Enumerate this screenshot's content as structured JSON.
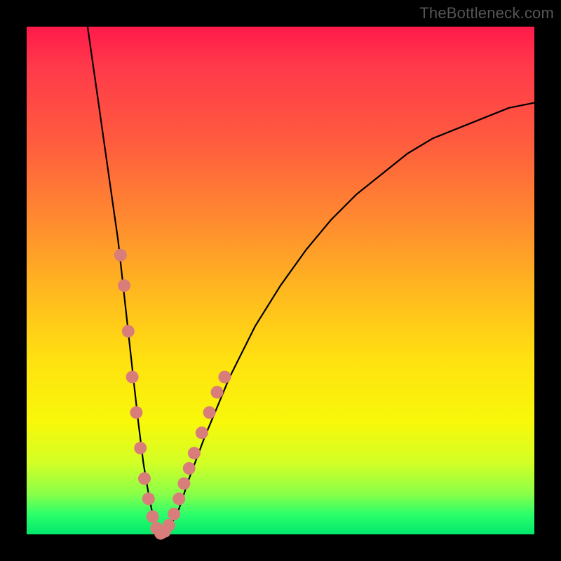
{
  "watermark": "TheBottleneck.com",
  "chart_data": {
    "type": "line",
    "title": "",
    "xlabel": "",
    "ylabel": "",
    "xlim": [
      0,
      100
    ],
    "ylim": [
      0,
      100
    ],
    "series": [
      {
        "name": "bottleneck-curve",
        "x": [
          12,
          14,
          16,
          18,
          19,
          20,
          21,
          22,
          23,
          24,
          25,
          26.5,
          28,
          30,
          32,
          35,
          40,
          45,
          50,
          55,
          60,
          65,
          70,
          75,
          80,
          85,
          90,
          95,
          100
        ],
        "y": [
          100,
          86,
          72,
          58,
          49,
          40,
          31,
          22,
          14,
          8,
          3,
          0,
          1,
          5,
          11,
          19,
          31,
          41,
          49,
          56,
          62,
          67,
          71,
          75,
          78,
          80,
          82,
          84,
          85
        ]
      }
    ],
    "markers": [
      {
        "name": "left-branch-dots",
        "color": "#d97d7a",
        "radius_px": 9,
        "points_xy": [
          [
            18.5,
            55
          ],
          [
            19.2,
            49
          ],
          [
            20.0,
            40
          ],
          [
            20.8,
            31
          ],
          [
            21.6,
            24
          ],
          [
            22.4,
            17
          ],
          [
            23.2,
            11
          ],
          [
            24.0,
            7
          ],
          [
            24.8,
            3.5
          ],
          [
            25.6,
            1.2
          ],
          [
            26.4,
            0.2
          ],
          [
            27.2,
            0.6
          ]
        ]
      },
      {
        "name": "right-branch-dots",
        "color": "#d97d7a",
        "radius_px": 9,
        "points_xy": [
          [
            28.0,
            1.8
          ],
          [
            29.0,
            4
          ],
          [
            30.0,
            7
          ],
          [
            31.0,
            10
          ],
          [
            32.0,
            13
          ],
          [
            33.0,
            16
          ],
          [
            34.5,
            20
          ],
          [
            36.0,
            24
          ],
          [
            37.5,
            28
          ],
          [
            39.0,
            31
          ]
        ]
      }
    ],
    "background_gradient": {
      "stops": [
        {
          "pos": 0.0,
          "color": "#ff1a4a"
        },
        {
          "pos": 0.22,
          "color": "#ff5a3f"
        },
        {
          "pos": 0.52,
          "color": "#ffb81f"
        },
        {
          "pos": 0.78,
          "color": "#f8f80a"
        },
        {
          "pos": 0.92,
          "color": "#8aff48"
        },
        {
          "pos": 1.0,
          "color": "#00e86b"
        }
      ]
    }
  }
}
